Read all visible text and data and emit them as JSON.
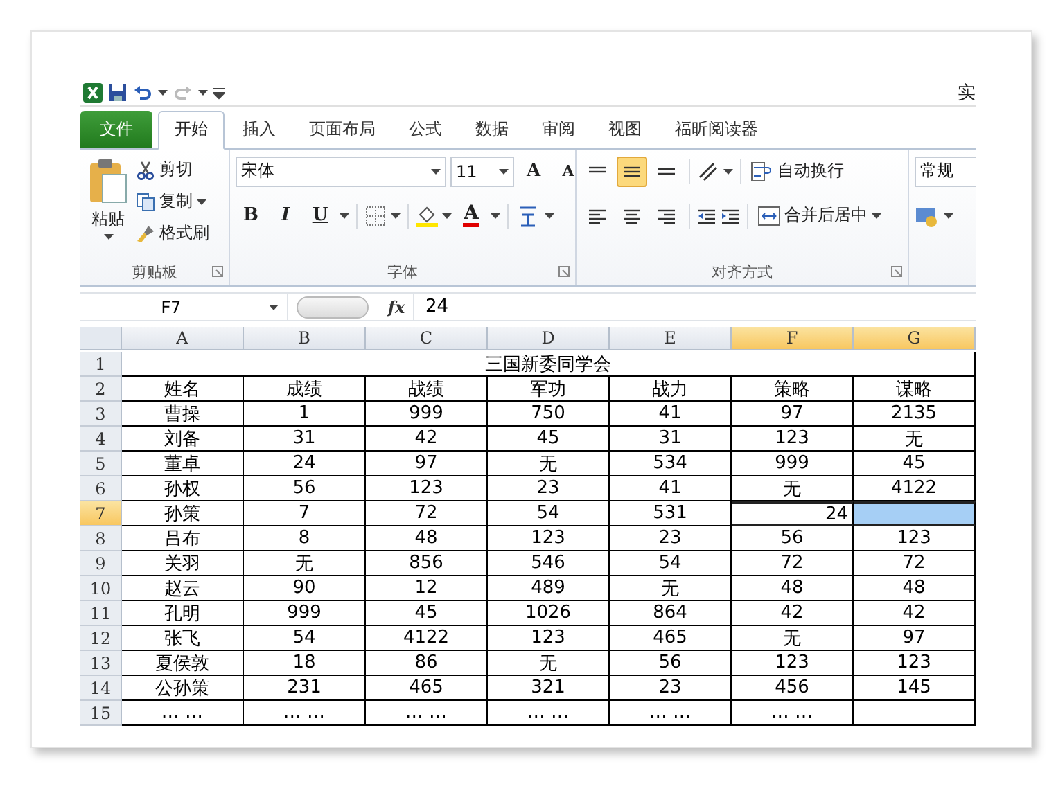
{
  "window": {
    "title": "实"
  },
  "tabs": [
    {
      "label": "文件",
      "kind": "file",
      "selected": false
    },
    {
      "label": "开始",
      "kind": "tab",
      "selected": true
    },
    {
      "label": "插入",
      "kind": "tab",
      "selected": false
    },
    {
      "label": "页面布局",
      "kind": "tab",
      "selected": false
    },
    {
      "label": "公式",
      "kind": "tab",
      "selected": false
    },
    {
      "label": "数据",
      "kind": "tab",
      "selected": false
    },
    {
      "label": "审阅",
      "kind": "tab",
      "selected": false
    },
    {
      "label": "视图",
      "kind": "tab",
      "selected": false
    },
    {
      "label": "福昕阅读器",
      "kind": "tab",
      "selected": false
    }
  ],
  "ribbon": {
    "clipboard": {
      "paste": "粘贴",
      "cut": "剪切",
      "copy": "复制",
      "format_painter": "格式刷",
      "group_label": "剪贴板"
    },
    "font": {
      "font_name": "宋体",
      "font_size": "11",
      "grow": "A",
      "shrink": "A",
      "bold": "B",
      "italic": "I",
      "underline": "U",
      "font_color": "A",
      "group_label": "字体"
    },
    "alignment": {
      "middle_align_selected": true,
      "wrap_text": "自动换行",
      "merge_center": "合并后居中",
      "group_label": "对齐方式"
    },
    "number": {
      "format": "常规"
    }
  },
  "formula_bar": {
    "name_box": "F7",
    "function_label": "fx",
    "value": "24"
  },
  "sheet": {
    "columns": [
      {
        "label": "A",
        "selected": false
      },
      {
        "label": "B",
        "selected": false
      },
      {
        "label": "C",
        "selected": false
      },
      {
        "label": "D",
        "selected": false
      },
      {
        "label": "E",
        "selected": false
      },
      {
        "label": "F",
        "selected": true
      },
      {
        "label": "G",
        "selected": true
      }
    ],
    "rows": [
      {
        "number": "1",
        "selected": false,
        "kind": "title",
        "cells": [
          {},
          {},
          {},
          {
            "text": "三国新委同学会"
          },
          {},
          {},
          {}
        ]
      },
      {
        "number": "2",
        "selected": false,
        "kind": "data",
        "cells": [
          {
            "text": "姓名"
          },
          {
            "text": "成绩"
          },
          {
            "text": "战绩"
          },
          {
            "text": "军功"
          },
          {
            "text": "战力"
          },
          {
            "text": "策略"
          },
          {
            "text": "谋略"
          }
        ]
      },
      {
        "number": "3",
        "selected": false,
        "kind": "data",
        "cells": [
          {
            "text": "曹操"
          },
          {
            "text": "1"
          },
          {
            "text": "999"
          },
          {
            "text": "750"
          },
          {
            "text": "41"
          },
          {
            "text": "97"
          },
          {
            "text": "2135"
          }
        ]
      },
      {
        "number": "4",
        "selected": false,
        "kind": "data",
        "cells": [
          {
            "text": "刘备"
          },
          {
            "text": "31"
          },
          {
            "text": "42"
          },
          {
            "text": "45"
          },
          {
            "text": "31"
          },
          {
            "text": "123"
          },
          {
            "text": "无"
          }
        ]
      },
      {
        "number": "5",
        "selected": false,
        "kind": "data",
        "cells": [
          {
            "text": "董卓"
          },
          {
            "text": "24"
          },
          {
            "text": "97"
          },
          {
            "text": "无"
          },
          {
            "text": "534"
          },
          {
            "text": "999"
          },
          {
            "text": "45"
          }
        ]
      },
      {
        "number": "6",
        "selected": false,
        "kind": "data",
        "cells": [
          {
            "text": "孙权"
          },
          {
            "text": "56"
          },
          {
            "text": "123"
          },
          {
            "text": "23"
          },
          {
            "text": "41"
          },
          {
            "text": "无"
          },
          {
            "text": "4122"
          }
        ]
      },
      {
        "number": "7",
        "selected": true,
        "kind": "data",
        "cells": [
          {
            "text": "孙策"
          },
          {
            "text": "7"
          },
          {
            "text": "72"
          },
          {
            "text": "54"
          },
          {
            "text": "531"
          },
          {
            "text": "24",
            "selected": true,
            "active": true
          },
          {
            "selected": true,
            "active": false
          }
        ]
      },
      {
        "number": "8",
        "selected": false,
        "kind": "data",
        "cells": [
          {
            "text": "吕布"
          },
          {
            "text": "8"
          },
          {
            "text": "48"
          },
          {
            "text": "123"
          },
          {
            "text": "23"
          },
          {
            "text": "56"
          },
          {
            "text": "123"
          }
        ]
      },
      {
        "number": "9",
        "selected": false,
        "kind": "data",
        "cells": [
          {
            "text": "关羽"
          },
          {
            "text": "无"
          },
          {
            "text": "856"
          },
          {
            "text": "546"
          },
          {
            "text": "54"
          },
          {
            "text": "72"
          },
          {
            "text": "72"
          }
        ]
      },
      {
        "number": "10",
        "selected": false,
        "kind": "data",
        "cells": [
          {
            "text": "赵云"
          },
          {
            "text": "90"
          },
          {
            "text": "12"
          },
          {
            "text": "489"
          },
          {
            "text": "无"
          },
          {
            "text": "48"
          },
          {
            "text": "48"
          }
        ]
      },
      {
        "number": "11",
        "selected": false,
        "kind": "data",
        "cells": [
          {
            "text": "孔明"
          },
          {
            "text": "999"
          },
          {
            "text": "45"
          },
          {
            "text": "1026"
          },
          {
            "text": "864"
          },
          {
            "text": "42"
          },
          {
            "text": "42"
          }
        ]
      },
      {
        "number": "12",
        "selected": false,
        "kind": "data",
        "cells": [
          {
            "text": "张飞"
          },
          {
            "text": "54"
          },
          {
            "text": "4122"
          },
          {
            "text": "123"
          },
          {
            "text": "465"
          },
          {
            "text": "无"
          },
          {
            "text": "97"
          }
        ]
      },
      {
        "number": "13",
        "selected": false,
        "kind": "data",
        "cells": [
          {
            "text": "夏侯敦"
          },
          {
            "text": "18"
          },
          {
            "text": "86"
          },
          {
            "text": "无"
          },
          {
            "text": "56"
          },
          {
            "text": "123"
          },
          {
            "text": "123"
          }
        ]
      },
      {
        "number": "14",
        "selected": false,
        "kind": "data",
        "cells": [
          {
            "text": "公孙策"
          },
          {
            "text": "231"
          },
          {
            "text": "465"
          },
          {
            "text": "321"
          },
          {
            "text": "23"
          },
          {
            "text": "456"
          },
          {
            "text": "145"
          }
        ]
      },
      {
        "number": "15",
        "selected": false,
        "kind": "data",
        "cells": [
          {
            "text": "… …"
          },
          {
            "text": "… …"
          },
          {
            "text": "… …"
          },
          {
            "text": "… …"
          },
          {
            "text": "… …"
          },
          {
            "text": "… …"
          },
          {}
        ]
      }
    ]
  }
}
